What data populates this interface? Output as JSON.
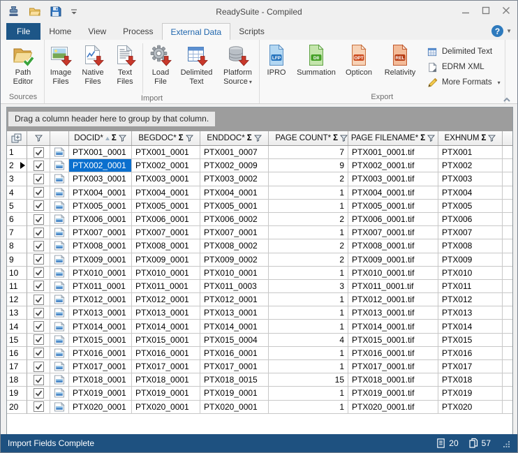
{
  "titlebar": {
    "title": "ReadySuite - Compiled",
    "qat_icons": [
      "app-logo",
      "open-folder",
      "save",
      "qat-dropdown"
    ],
    "window_buttons": [
      "minimize",
      "maximize",
      "close"
    ]
  },
  "tabs": {
    "items": [
      "File",
      "Home",
      "View",
      "Process",
      "External Data",
      "Scripts"
    ],
    "selected": "External Data",
    "help_label": "?"
  },
  "ribbon": {
    "groups": [
      {
        "label": "Sources",
        "buttons": [
          {
            "lines": [
              "Path",
              "Editor"
            ],
            "icon": "path-editor"
          }
        ]
      },
      {
        "label": "Import",
        "buttons": [
          {
            "lines": [
              "Image",
              "Files"
            ],
            "icon": "image-files"
          },
          {
            "lines": [
              "Native",
              "Files"
            ],
            "icon": "native-files"
          },
          {
            "lines": [
              "Text",
              "Files"
            ],
            "icon": "text-files"
          },
          {
            "sep": true
          },
          {
            "lines": [
              "Load",
              "File"
            ],
            "icon": "load-file"
          },
          {
            "lines": [
              "Delimited",
              "Text"
            ],
            "icon": "delimited-text"
          },
          {
            "lines": [
              "Platform",
              "Source"
            ],
            "icon": "platform-source",
            "dropdown": true
          }
        ]
      },
      {
        "label": "Export",
        "buttons": [
          {
            "lines": [
              "IPRO"
            ],
            "icon": "file-badge",
            "badge": "LFP",
            "colors": [
              "#b3d7f2",
              "#5a90c4",
              "#2573bd"
            ]
          },
          {
            "lines": [
              "Summation"
            ],
            "icon": "file-badge",
            "badge": "DII",
            "colors": [
              "#c4e5ac",
              "#5fa344",
              "#44a026"
            ]
          },
          {
            "lines": [
              "Opticon"
            ],
            "icon": "file-badge",
            "badge": "OPT",
            "colors": [
              "#f7d2b6",
              "#c8703e",
              "#cc4a1e"
            ]
          },
          {
            "lines": [
              "Relativity"
            ],
            "icon": "file-badge",
            "badge": "REL",
            "colors": [
              "#f3bb98",
              "#c05a30",
              "#b63c14"
            ]
          }
        ],
        "small_buttons": [
          {
            "label": "Delimited Text",
            "icon": "delimited-text-small"
          },
          {
            "label": "EDRM XML",
            "icon": "edrm-xml"
          },
          {
            "label": "More Formats",
            "icon": "more-formats",
            "dropdown": true
          }
        ]
      }
    ]
  },
  "grid": {
    "groupby_hint": "Drag a column header here to group by that column.",
    "columns": [
      {
        "key": "docid",
        "label": "DOCID*",
        "sort": "asc"
      },
      {
        "key": "begdoc",
        "label": "BEGDOC*"
      },
      {
        "key": "enddoc",
        "label": "ENDDOC*"
      },
      {
        "key": "pages",
        "label": "PAGE COUNT*",
        "align": "right"
      },
      {
        "key": "filename",
        "label": "PAGE FILENAME*"
      },
      {
        "key": "exhnum",
        "label": "EXHNUM"
      }
    ],
    "selected_row": 2,
    "selected_column": "docid",
    "rows": [
      {
        "n": 1,
        "checked": true,
        "docid": "PTX001_0001",
        "begdoc": "PTX001_0001",
        "enddoc": "PTX001_0007",
        "pages": 7,
        "filename": "PTX001_0001.tif",
        "exhnum": "PTX001"
      },
      {
        "n": 2,
        "checked": true,
        "docid": "PTX002_0001",
        "begdoc": "PTX002_0001",
        "enddoc": "PTX002_0009",
        "pages": 9,
        "filename": "PTX002_0001.tif",
        "exhnum": "PTX002"
      },
      {
        "n": 3,
        "checked": true,
        "docid": "PTX003_0001",
        "begdoc": "PTX003_0001",
        "enddoc": "PTX003_0002",
        "pages": 2,
        "filename": "PTX003_0001.tif",
        "exhnum": "PTX003"
      },
      {
        "n": 4,
        "checked": true,
        "docid": "PTX004_0001",
        "begdoc": "PTX004_0001",
        "enddoc": "PTX004_0001",
        "pages": 1,
        "filename": "PTX004_0001.tif",
        "exhnum": "PTX004"
      },
      {
        "n": 5,
        "checked": true,
        "docid": "PTX005_0001",
        "begdoc": "PTX005_0001",
        "enddoc": "PTX005_0001",
        "pages": 1,
        "filename": "PTX005_0001.tif",
        "exhnum": "PTX005"
      },
      {
        "n": 6,
        "checked": true,
        "docid": "PTX006_0001",
        "begdoc": "PTX006_0001",
        "enddoc": "PTX006_0002",
        "pages": 2,
        "filename": "PTX006_0001.tif",
        "exhnum": "PTX006"
      },
      {
        "n": 7,
        "checked": true,
        "docid": "PTX007_0001",
        "begdoc": "PTX007_0001",
        "enddoc": "PTX007_0001",
        "pages": 1,
        "filename": "PTX007_0001.tif",
        "exhnum": "PTX007"
      },
      {
        "n": 8,
        "checked": true,
        "docid": "PTX008_0001",
        "begdoc": "PTX008_0001",
        "enddoc": "PTX008_0002",
        "pages": 2,
        "filename": "PTX008_0001.tif",
        "exhnum": "PTX008"
      },
      {
        "n": 9,
        "checked": true,
        "docid": "PTX009_0001",
        "begdoc": "PTX009_0001",
        "enddoc": "PTX009_0002",
        "pages": 2,
        "filename": "PTX009_0001.tif",
        "exhnum": "PTX009"
      },
      {
        "n": 10,
        "checked": true,
        "docid": "PTX010_0001",
        "begdoc": "PTX010_0001",
        "enddoc": "PTX010_0001",
        "pages": 1,
        "filename": "PTX010_0001.tif",
        "exhnum": "PTX010"
      },
      {
        "n": 11,
        "checked": true,
        "docid": "PTX011_0001",
        "begdoc": "PTX011_0001",
        "enddoc": "PTX011_0003",
        "pages": 3,
        "filename": "PTX011_0001.tif",
        "exhnum": "PTX011"
      },
      {
        "n": 12,
        "checked": true,
        "docid": "PTX012_0001",
        "begdoc": "PTX012_0001",
        "enddoc": "PTX012_0001",
        "pages": 1,
        "filename": "PTX012_0001.tif",
        "exhnum": "PTX012"
      },
      {
        "n": 13,
        "checked": true,
        "docid": "PTX013_0001",
        "begdoc": "PTX013_0001",
        "enddoc": "PTX013_0001",
        "pages": 1,
        "filename": "PTX013_0001.tif",
        "exhnum": "PTX013"
      },
      {
        "n": 14,
        "checked": true,
        "docid": "PTX014_0001",
        "begdoc": "PTX014_0001",
        "enddoc": "PTX014_0001",
        "pages": 1,
        "filename": "PTX014_0001.tif",
        "exhnum": "PTX014"
      },
      {
        "n": 15,
        "checked": true,
        "docid": "PTX015_0001",
        "begdoc": "PTX015_0001",
        "enddoc": "PTX015_0004",
        "pages": 4,
        "filename": "PTX015_0001.tif",
        "exhnum": "PTX015"
      },
      {
        "n": 16,
        "checked": true,
        "docid": "PTX016_0001",
        "begdoc": "PTX016_0001",
        "enddoc": "PTX016_0001",
        "pages": 1,
        "filename": "PTX016_0001.tif",
        "exhnum": "PTX016"
      },
      {
        "n": 17,
        "checked": true,
        "docid": "PTX017_0001",
        "begdoc": "PTX017_0001",
        "enddoc": "PTX017_0001",
        "pages": 1,
        "filename": "PTX017_0001.tif",
        "exhnum": "PTX017"
      },
      {
        "n": 18,
        "checked": true,
        "docid": "PTX018_0001",
        "begdoc": "PTX018_0001",
        "enddoc": "PTX018_0015",
        "pages": 15,
        "filename": "PTX018_0001.tif",
        "exhnum": "PTX018"
      },
      {
        "n": 19,
        "checked": true,
        "docid": "PTX019_0001",
        "begdoc": "PTX019_0001",
        "enddoc": "PTX019_0001",
        "pages": 1,
        "filename": "PTX019_0001.tif",
        "exhnum": "PTX019"
      },
      {
        "n": 20,
        "checked": true,
        "docid": "PTX020_0001",
        "begdoc": "PTX020_0001",
        "enddoc": "PTX020_0001",
        "pages": 1,
        "filename": "PTX020_0001.tif",
        "exhnum": "PTX020"
      }
    ]
  },
  "statusbar": {
    "text": "Import Fields Complete",
    "documents": "20",
    "pages": "57"
  }
}
